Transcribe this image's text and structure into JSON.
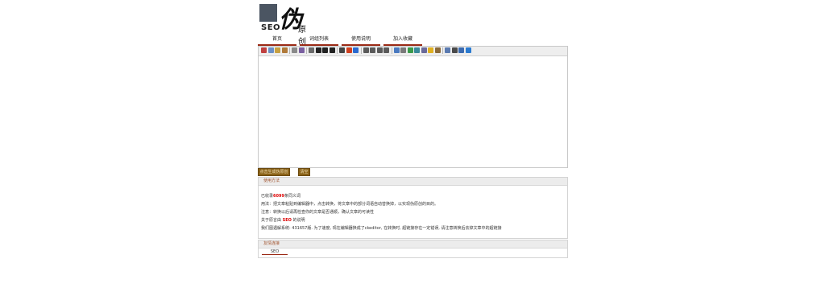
{
  "logo": {
    "seo": "SEO",
    "big": "伪",
    "small": "原创"
  },
  "nav": [
    "首页",
    "词组列表",
    "使用说明",
    "加入收藏"
  ],
  "toolbar": {
    "icons": [
      {
        "name": "cut-icon",
        "color": "#c04040"
      },
      {
        "name": "copy-icon",
        "color": "#6a8fc7"
      },
      {
        "name": "paste-icon",
        "color": "#c8a040"
      },
      {
        "name": "paste-text-icon",
        "color": "#b07a3a"
      },
      {
        "name": "sep"
      },
      {
        "name": "find-icon",
        "color": "#8a8a8a"
      },
      {
        "name": "replace-icon",
        "color": "#7a5fa0"
      },
      {
        "name": "sep"
      },
      {
        "name": "print-icon",
        "color": "#6a6a6a"
      },
      {
        "name": "bold-icon",
        "color": "#222222"
      },
      {
        "name": "italic-icon",
        "color": "#222222"
      },
      {
        "name": "underline-icon",
        "color": "#222222"
      },
      {
        "name": "sep"
      },
      {
        "name": "strike-icon",
        "color": "#444444"
      },
      {
        "name": "font-color-icon",
        "color": "#d04020"
      },
      {
        "name": "bg-color-icon",
        "color": "#2a6ad0"
      },
      {
        "name": "sep"
      },
      {
        "name": "align-left-icon",
        "color": "#5a5a5a"
      },
      {
        "name": "align-center-icon",
        "color": "#5a5a5a"
      },
      {
        "name": "align-right-icon",
        "color": "#5a5a5a"
      },
      {
        "name": "align-justify-icon",
        "color": "#5a5a5a"
      },
      {
        "name": "sep"
      },
      {
        "name": "link-icon",
        "color": "#4a7ac0"
      },
      {
        "name": "unlink-icon",
        "color": "#7a7a7a"
      },
      {
        "name": "anchor-icon",
        "color": "#3a9a4a"
      },
      {
        "name": "image-icon",
        "color": "#3a8a9a"
      },
      {
        "name": "table-icon",
        "color": "#6a6a9a"
      },
      {
        "name": "smiley-icon",
        "color": "#e0b020"
      },
      {
        "name": "special-char-icon",
        "color": "#8a6a3a"
      },
      {
        "name": "sep"
      },
      {
        "name": "preview-icon",
        "color": "#5a7ab0"
      },
      {
        "name": "source-icon",
        "color": "#4a4a4a"
      },
      {
        "name": "fullscreen-icon",
        "color": "#3a6ab0"
      },
      {
        "name": "about-icon",
        "color": "#2a7ad0"
      }
    ]
  },
  "buttons": {
    "pseudo_original": "点击生成伪原创",
    "clear": "清空"
  },
  "usage": {
    "title": "使用方法",
    "lines": [
      {
        "pre": "已收录",
        "red": "6099",
        "post": "条同义词"
      },
      {
        "pre": "用法：把文章粘贴到编辑器中，点击转换，将文章中的部分词语自动替换掉，以实现伪原创的目的。",
        "red": "",
        "post": ""
      },
      {
        "pre": "注意：转换以后请再检查你的文章是否通顺，确认文章的可读性",
        "red": "",
        "post": ""
      },
      {
        "pre": "关于原言由 ",
        "red": "SEO",
        "post": " 的说明"
      },
      {
        "pre": "我们图遇解系统: 431657版. 为了速度, 现在编辑器换成了ckeditor, 在转换时, 超链接存在一定错误, 请注意转换后去掉文章中的超链接",
        "red": "",
        "post": ""
      }
    ]
  },
  "links": {
    "title": "友情连接",
    "items": [
      "SEO"
    ]
  }
}
